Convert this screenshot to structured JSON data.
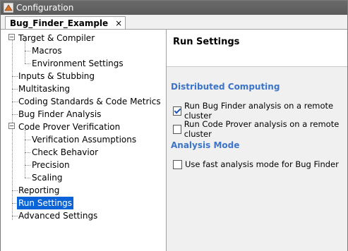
{
  "window": {
    "title": "Configuration",
    "icon": "matlab-gear-icon"
  },
  "tab": {
    "label": "Bug_Finder_Example",
    "close": "×"
  },
  "tree": {
    "items": [
      {
        "label": "Target & Compiler",
        "expander": "−"
      },
      {
        "label": "Macros"
      },
      {
        "label": "Environment Settings"
      },
      {
        "label": "Inputs & Stubbing"
      },
      {
        "label": "Multitasking"
      },
      {
        "label": "Coding Standards & Code Metrics"
      },
      {
        "label": "Bug Finder Analysis"
      },
      {
        "label": "Code Prover Verification",
        "expander": "−"
      },
      {
        "label": "Verification Assumptions"
      },
      {
        "label": "Check Behavior"
      },
      {
        "label": "Precision"
      },
      {
        "label": "Scaling"
      },
      {
        "label": "Reporting"
      },
      {
        "label": "Run Settings",
        "selected": true
      },
      {
        "label": "Advanced Settings"
      }
    ]
  },
  "panel": {
    "title": "Run Settings",
    "sections": [
      {
        "title": "Distributed Computing",
        "options": [
          {
            "label": "Run Bug Finder analysis on a remote cluster",
            "checked": true
          },
          {
            "label": "Run Code Prover analysis on a remote cluster",
            "checked": false
          }
        ]
      },
      {
        "title": "Analysis Mode",
        "options": [
          {
            "label": "Use fast analysis mode for Bug Finder",
            "checked": false
          }
        ]
      }
    ]
  },
  "colors": {
    "accent": "#3b74c9",
    "selection": "#0a64d8"
  }
}
